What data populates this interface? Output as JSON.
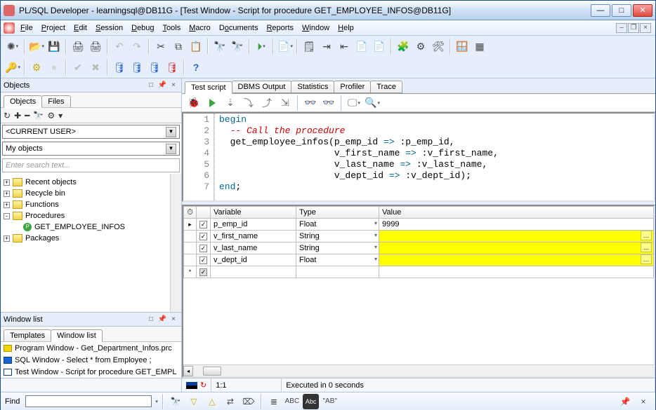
{
  "title": "PL/SQL Developer - learningsql@DB11G - [Test Window - Script for procedure GET_EMPLOYEE_INFOS@DB11G]",
  "menu": [
    "File",
    "Project",
    "Edit",
    "Session",
    "Debug",
    "Tools",
    "Macro",
    "Documents",
    "Reports",
    "Window",
    "Help"
  ],
  "left": {
    "objects_header": "Objects",
    "objects_tabs": [
      "Objects",
      "Files"
    ],
    "current_user": "<CURRENT USER>",
    "my_objects": "My objects",
    "search_placeholder": "Enter search text...",
    "tree": [
      {
        "label": "Recent objects",
        "expand": "▸"
      },
      {
        "label": "Recycle bin",
        "expand": "▸"
      },
      {
        "label": "Functions",
        "expand": "▸"
      },
      {
        "label": "Procedures",
        "expand": "▾",
        "children": [
          {
            "label": "GET_EMPLOYEE_INFOS",
            "icon": "proc"
          }
        ]
      },
      {
        "label": "Packages",
        "expand": "▸"
      }
    ],
    "windowlist_header": "Window list",
    "wtabs": [
      "Templates",
      "Window list"
    ],
    "windows": [
      {
        "icon": "y",
        "label": "Program Window - Get_Department_Infos.prc"
      },
      {
        "icon": "b",
        "label": "SQL Window - Select * from Employee ;"
      },
      {
        "icon": "b2",
        "label": "Test Window - Script for procedure GET_EMPL"
      }
    ]
  },
  "right": {
    "tabs": [
      "Test script",
      "DBMS Output",
      "Statistics",
      "Profiler",
      "Trace"
    ],
    "active_tab": "Test script",
    "code_lines": [
      "begin",
      "  -- Call the procedure",
      "  get_employee_infos(p_emp_id => :p_emp_id,",
      "                     v_first_name => :v_first_name,",
      "                     v_last_name => :v_last_name,",
      "                     v_dept_id => :v_dept_id);",
      "end;"
    ],
    "var_headers": [
      "",
      "",
      "Variable",
      "Type",
      "Value"
    ],
    "vars": [
      {
        "ind": "▸",
        "chk": true,
        "name": "p_emp_id",
        "type": "Float",
        "value": "9999",
        "yellow": false
      },
      {
        "ind": "",
        "chk": true,
        "name": "v_first_name",
        "type": "String",
        "value": "",
        "yellow": true
      },
      {
        "ind": "",
        "chk": true,
        "name": "v_last_name",
        "type": "String",
        "value": "",
        "yellow": true
      },
      {
        "ind": "",
        "chk": true,
        "name": "v_dept_id",
        "type": "Float",
        "value": "",
        "yellow": true
      },
      {
        "ind": "*",
        "chk": false,
        "name": "",
        "type": "",
        "value": "",
        "yellow": false,
        "disabled": true
      }
    ]
  },
  "status": {
    "pos": "1:1",
    "exec": "Executed in 0 seconds"
  },
  "find": {
    "label": "Find",
    "value": "",
    "ab_literal": "\"AB\""
  }
}
